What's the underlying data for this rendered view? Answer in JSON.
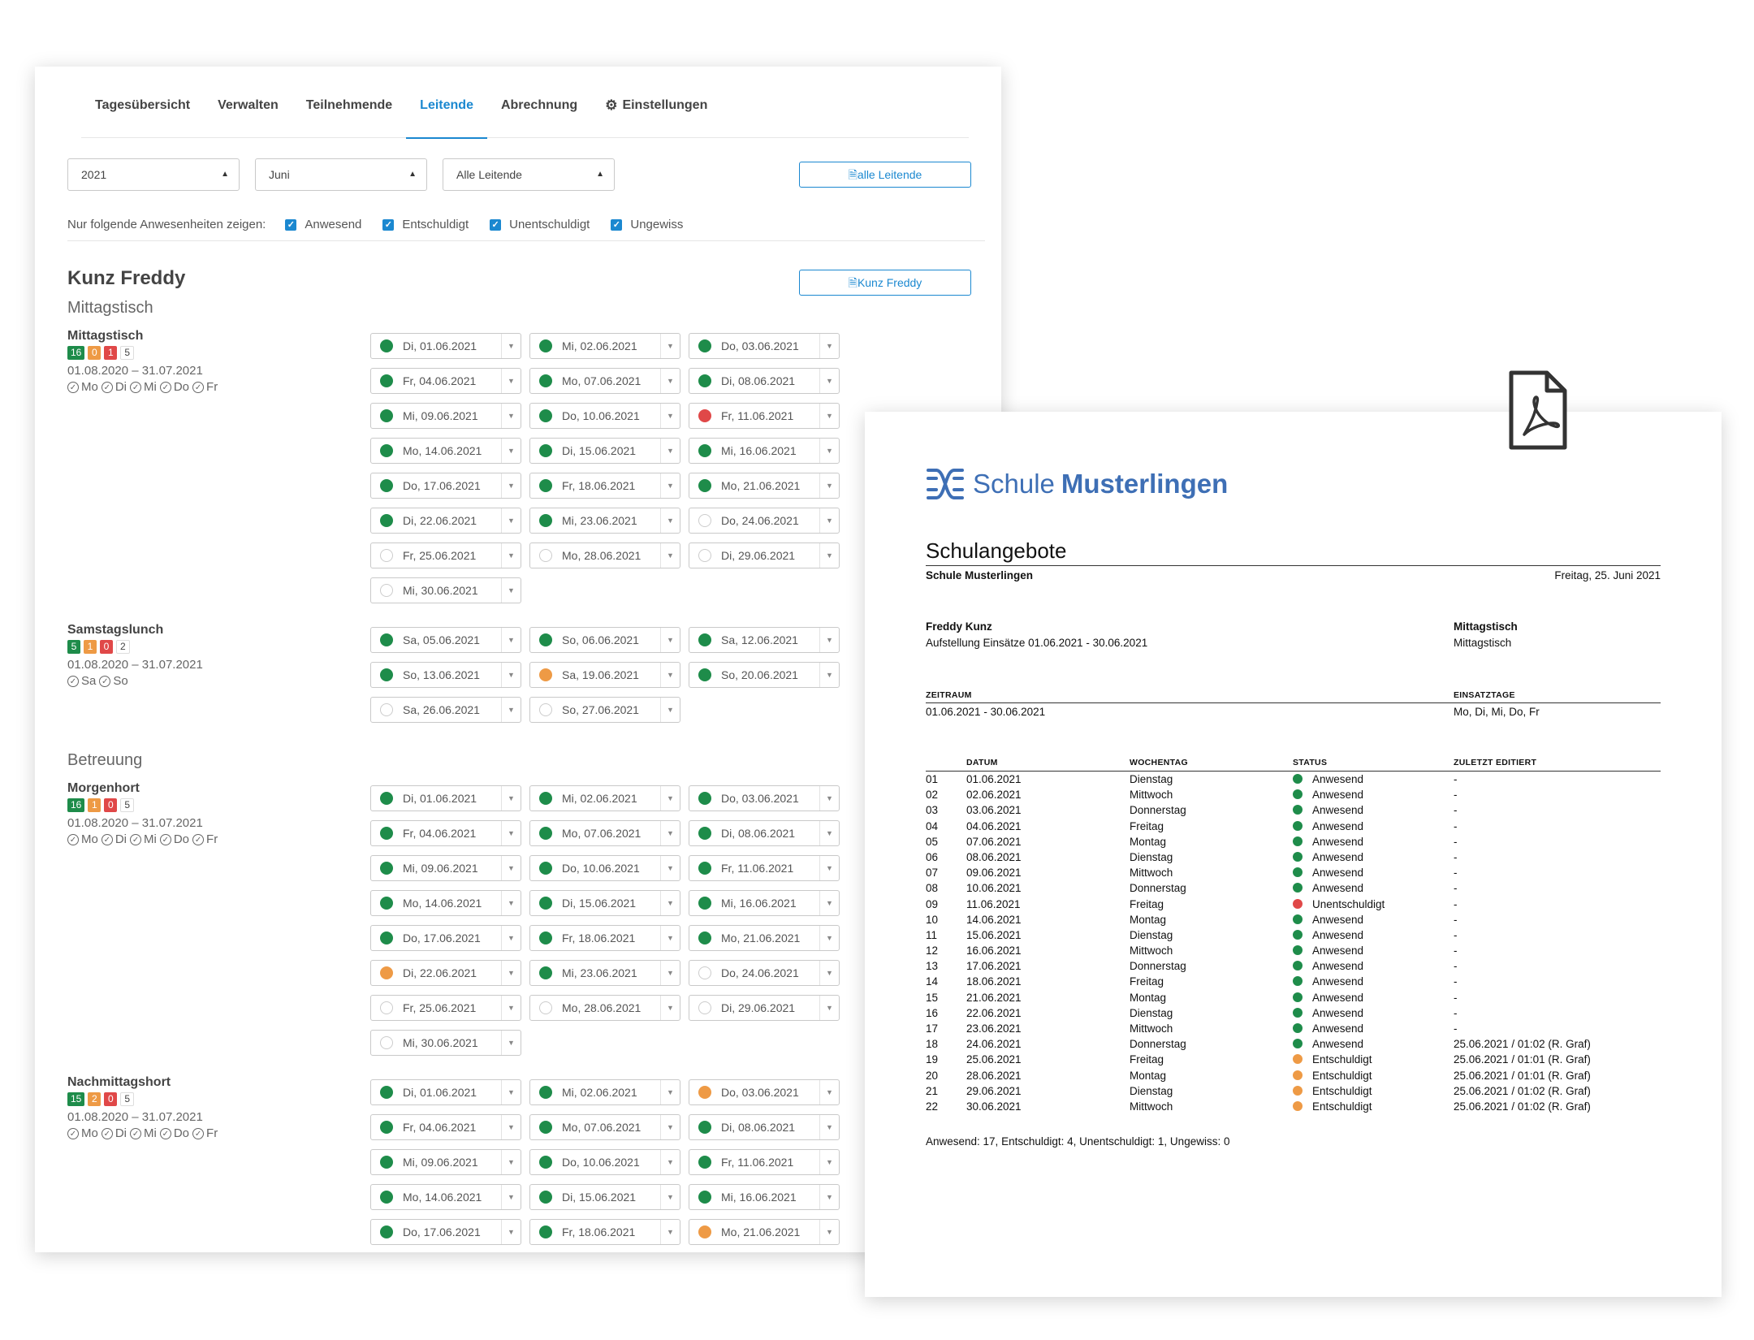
{
  "tabs": [
    {
      "label": "Tagesübersicht",
      "active": false
    },
    {
      "label": "Verwalten",
      "active": false
    },
    {
      "label": "Teilnehmende",
      "active": false
    },
    {
      "label": "Leitende",
      "active": true
    },
    {
      "label": "Abrechnung",
      "active": false
    },
    {
      "label": "Einstellungen",
      "active": false,
      "icon": "gear-icon"
    }
  ],
  "filters": {
    "year": "2021",
    "month": "Juni",
    "leader": "Alle Leitende",
    "all_pdf_label": "alle Leitende"
  },
  "attendance_filter": {
    "label": "Nur folgende Anwesenheiten zeigen:",
    "options": [
      {
        "label": "Anwesend",
        "checked": true
      },
      {
        "label": "Entschuldigt",
        "checked": true
      },
      {
        "label": "Unentschuldigt",
        "checked": true
      },
      {
        "label": "Ungewiss",
        "checked": true
      }
    ]
  },
  "person": {
    "name": "Kunz Freddy",
    "pdf_label": "Kunz Freddy"
  },
  "status_colors": {
    "green": "#1e8c4a",
    "orange": "#ee9a45",
    "red": "#e04848",
    "empty": "#ffffff",
    "accent": "#1b88d0"
  },
  "groups": [
    {
      "title": "Mittagstisch"
    },
    {
      "title": "Betreuung"
    }
  ],
  "offers": [
    {
      "name": "Mittagstisch",
      "badges": [
        "16",
        "0",
        "1",
        "5"
      ],
      "period": "01.08.2020 – 31.07.2021",
      "days": "Mo Di Mi Do Fr",
      "dates": [
        [
          "Di, 01.06.2021",
          "green"
        ],
        [
          "Mi, 02.06.2021",
          "green"
        ],
        [
          "Do, 03.06.2021",
          "green"
        ],
        [
          "Fr, 04.06.2021",
          "green"
        ],
        [
          "Mo, 07.06.2021",
          "green"
        ],
        [
          "Di, 08.06.2021",
          "green"
        ],
        [
          "Mi, 09.06.2021",
          "green"
        ],
        [
          "Do, 10.06.2021",
          "green"
        ],
        [
          "Fr, 11.06.2021",
          "red"
        ],
        [
          "Mo, 14.06.2021",
          "green"
        ],
        [
          "Di, 15.06.2021",
          "green"
        ],
        [
          "Mi, 16.06.2021",
          "green"
        ],
        [
          "Do, 17.06.2021",
          "green"
        ],
        [
          "Fr, 18.06.2021",
          "green"
        ],
        [
          "Mo, 21.06.2021",
          "green"
        ],
        [
          "Di, 22.06.2021",
          "green"
        ],
        [
          "Mi, 23.06.2021",
          "green"
        ],
        [
          "Do, 24.06.2021",
          "empty"
        ],
        [
          "Fr, 25.06.2021",
          "empty"
        ],
        [
          "Mo, 28.06.2021",
          "empty"
        ],
        [
          "Di, 29.06.2021",
          "empty"
        ],
        [
          "Mi, 30.06.2021",
          "empty"
        ]
      ]
    },
    {
      "name": "Samstagslunch",
      "badges": [
        "5",
        "1",
        "0",
        "2"
      ],
      "period": "01.08.2020 – 31.07.2021",
      "days": "Sa So",
      "dates": [
        [
          "Sa, 05.06.2021",
          "green"
        ],
        [
          "So, 06.06.2021",
          "green"
        ],
        [
          "Sa, 12.06.2021",
          "green"
        ],
        [
          "So, 13.06.2021",
          "green"
        ],
        [
          "Sa, 19.06.2021",
          "orange"
        ],
        [
          "So, 20.06.2021",
          "green"
        ],
        [
          "Sa, 26.06.2021",
          "empty"
        ],
        [
          "So, 27.06.2021",
          "empty"
        ]
      ]
    },
    {
      "name": "Morgenhort",
      "badges": [
        "16",
        "1",
        "0",
        "5"
      ],
      "period": "01.08.2020 – 31.07.2021",
      "days": "Mo Di Mi Do Fr",
      "dates": [
        [
          "Di, 01.06.2021",
          "green"
        ],
        [
          "Mi, 02.06.2021",
          "green"
        ],
        [
          "Do, 03.06.2021",
          "green"
        ],
        [
          "Fr, 04.06.2021",
          "green"
        ],
        [
          "Mo, 07.06.2021",
          "green"
        ],
        [
          "Di, 08.06.2021",
          "green"
        ],
        [
          "Mi, 09.06.2021",
          "green"
        ],
        [
          "Do, 10.06.2021",
          "green"
        ],
        [
          "Fr, 11.06.2021",
          "green"
        ],
        [
          "Mo, 14.06.2021",
          "green"
        ],
        [
          "Di, 15.06.2021",
          "green"
        ],
        [
          "Mi, 16.06.2021",
          "green"
        ],
        [
          "Do, 17.06.2021",
          "green"
        ],
        [
          "Fr, 18.06.2021",
          "green"
        ],
        [
          "Mo, 21.06.2021",
          "green"
        ],
        [
          "Di, 22.06.2021",
          "orange"
        ],
        [
          "Mi, 23.06.2021",
          "green"
        ],
        [
          "Do, 24.06.2021",
          "empty"
        ],
        [
          "Fr, 25.06.2021",
          "empty"
        ],
        [
          "Mo, 28.06.2021",
          "empty"
        ],
        [
          "Di, 29.06.2021",
          "empty"
        ],
        [
          "Mi, 30.06.2021",
          "empty"
        ]
      ]
    },
    {
      "name": "Nachmittagshort",
      "badges": [
        "15",
        "2",
        "0",
        "5"
      ],
      "period": "01.08.2020 – 31.07.2021",
      "days": "Mo Di Mi Do Fr",
      "dates": [
        [
          "Di, 01.06.2021",
          "green"
        ],
        [
          "Mi, 02.06.2021",
          "green"
        ],
        [
          "Do, 03.06.2021",
          "orange"
        ],
        [
          "Fr, 04.06.2021",
          "green"
        ],
        [
          "Mo, 07.06.2021",
          "green"
        ],
        [
          "Di, 08.06.2021",
          "green"
        ],
        [
          "Mi, 09.06.2021",
          "green"
        ],
        [
          "Do, 10.06.2021",
          "green"
        ],
        [
          "Fr, 11.06.2021",
          "green"
        ],
        [
          "Mo, 14.06.2021",
          "green"
        ],
        [
          "Di, 15.06.2021",
          "green"
        ],
        [
          "Mi, 16.06.2021",
          "green"
        ],
        [
          "Do, 17.06.2021",
          "green"
        ],
        [
          "Fr, 18.06.2021",
          "green"
        ],
        [
          "Mo, 21.06.2021",
          "orange"
        ]
      ]
    }
  ],
  "pdf": {
    "logo_light": "Schule",
    "logo_bold": "Musterlingen",
    "title": "Schulangebote",
    "school": "Schule Musterlingen",
    "date": "Freitag, 25. Juni 2021",
    "person": "Freddy Kunz",
    "subtitle": "Aufstellung Einsätze 01.06.2021 - 30.06.2021",
    "offer_title": "Mittagstisch",
    "offer_sub": "Mittagstisch",
    "zeitraum_label": "ZEITRAUM",
    "zeitraum": "01.06.2021 - 30.06.2021",
    "einsatztage_label": "EINSATZTAGE",
    "einsatztage": "Mo, Di, Mi, Do, Fr",
    "columns": [
      "DATUM",
      "WOCHENTAG",
      "STATUS",
      "ZULETZT EDITIERT"
    ],
    "rows": [
      [
        "01",
        "01.06.2021",
        "Dienstag",
        "Anwesend",
        "-"
      ],
      [
        "02",
        "02.06.2021",
        "Mittwoch",
        "Anwesend",
        "-"
      ],
      [
        "03",
        "03.06.2021",
        "Donnerstag",
        "Anwesend",
        "-"
      ],
      [
        "04",
        "04.06.2021",
        "Freitag",
        "Anwesend",
        "-"
      ],
      [
        "05",
        "07.06.2021",
        "Montag",
        "Anwesend",
        "-"
      ],
      [
        "06",
        "08.06.2021",
        "Dienstag",
        "Anwesend",
        "-"
      ],
      [
        "07",
        "09.06.2021",
        "Mittwoch",
        "Anwesend",
        "-"
      ],
      [
        "08",
        "10.06.2021",
        "Donnerstag",
        "Anwesend",
        "-"
      ],
      [
        "09",
        "11.06.2021",
        "Freitag",
        "Unentschuldigt",
        "-"
      ],
      [
        "10",
        "14.06.2021",
        "Montag",
        "Anwesend",
        "-"
      ],
      [
        "11",
        "15.06.2021",
        "Dienstag",
        "Anwesend",
        "-"
      ],
      [
        "12",
        "16.06.2021",
        "Mittwoch",
        "Anwesend",
        "-"
      ],
      [
        "13",
        "17.06.2021",
        "Donnerstag",
        "Anwesend",
        "-"
      ],
      [
        "14",
        "18.06.2021",
        "Freitag",
        "Anwesend",
        "-"
      ],
      [
        "15",
        "21.06.2021",
        "Montag",
        "Anwesend",
        "-"
      ],
      [
        "16",
        "22.06.2021",
        "Dienstag",
        "Anwesend",
        "-"
      ],
      [
        "17",
        "23.06.2021",
        "Mittwoch",
        "Anwesend",
        "-"
      ],
      [
        "18",
        "24.06.2021",
        "Donnerstag",
        "Anwesend",
        "25.06.2021 / 01:02 (R. Graf)"
      ],
      [
        "19",
        "25.06.2021",
        "Freitag",
        "Entschuldigt",
        "25.06.2021 / 01:01 (R. Graf)"
      ],
      [
        "20",
        "28.06.2021",
        "Montag",
        "Entschuldigt",
        "25.06.2021 / 01:01 (R. Graf)"
      ],
      [
        "21",
        "29.06.2021",
        "Dienstag",
        "Entschuldigt",
        "25.06.2021 / 01:02 (R. Graf)"
      ],
      [
        "22",
        "30.06.2021",
        "Mittwoch",
        "Entschuldigt",
        "25.06.2021 / 01:02 (R. Graf)"
      ]
    ],
    "summary": "Anwesend: 17, Entschuldigt: 4, Unentschuldigt: 1, Ungewiss: 0"
  }
}
